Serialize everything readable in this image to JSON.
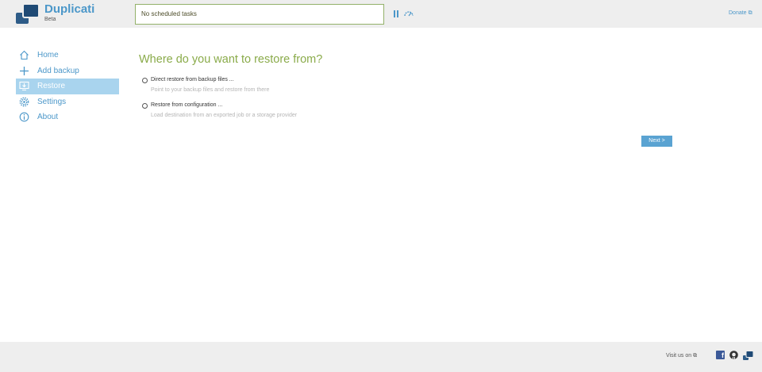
{
  "header": {
    "app_name": "Duplicati",
    "edition": "Beta",
    "status": "No scheduled tasks",
    "donate_label": "Donate",
    "icons": [
      "logo-icon",
      "pause-icon",
      "throttle-icon",
      "external-link-icon"
    ]
  },
  "sidebar": {
    "items": [
      {
        "label": "Home",
        "icon": "home-icon",
        "active": false
      },
      {
        "label": "Add backup",
        "icon": "plus-icon",
        "active": false
      },
      {
        "label": "Restore",
        "icon": "restore-icon",
        "active": true
      },
      {
        "label": "Settings",
        "icon": "gear-icon",
        "active": false
      },
      {
        "label": "About",
        "icon": "info-icon",
        "active": false
      }
    ]
  },
  "main": {
    "title": "Where do you want to restore from?",
    "options": [
      {
        "label": "Direct restore from backup files ...",
        "hint": "Point to your backup files and restore from there",
        "selected": false
      },
      {
        "label": "Restore from configuration ...",
        "hint": "Load destination from an exported job or a storage provider",
        "selected": false
      }
    ],
    "next_label": "Next >"
  },
  "footer": {
    "visit_label": "Visit us on",
    "icons": [
      "facebook-icon",
      "github-icon",
      "duplicati-icon"
    ]
  },
  "colors": {
    "accent": "#4b97c9",
    "title_green": "#8aab4a",
    "active_nav": "#a9d4ee",
    "button": "#5aa3d2",
    "chrome": "#eeeeee"
  }
}
